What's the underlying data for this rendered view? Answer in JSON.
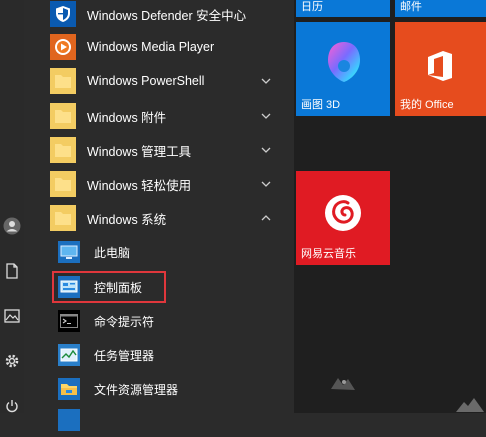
{
  "apps": [
    {
      "label": "Windows Defender 安全中心",
      "icon": "shield-icon",
      "tile_color": "#0a5ab0"
    },
    {
      "label": "Windows Media Player",
      "icon": "media-player-icon",
      "tile_color": "#e0651e"
    },
    {
      "label": "Windows PowerShell",
      "icon": "folder-icon",
      "tile_color": "#f3cc62"
    },
    {
      "label": "Windows 附件",
      "icon": "folder-icon",
      "tile_color": "#f3cc62"
    },
    {
      "label": "Windows 管理工具",
      "icon": "folder-icon",
      "tile_color": "#f3cc62"
    },
    {
      "label": "Windows 轻松使用",
      "icon": "folder-icon",
      "tile_color": "#f3cc62"
    },
    {
      "label": "Windows 系统",
      "icon": "folder-icon",
      "tile_color": "#f3cc62"
    }
  ],
  "system_items": [
    {
      "label": "此电脑",
      "icon": "this-pc-icon"
    },
    {
      "label": "控制面板",
      "icon": "control-panel-icon"
    },
    {
      "label": "命令提示符",
      "icon": "command-prompt-icon"
    },
    {
      "label": "任务管理器",
      "icon": "task-manager-icon"
    },
    {
      "label": "文件资源管理器",
      "icon": "file-explorer-icon"
    }
  ],
  "tiles": {
    "calendar": "日历",
    "mail": "邮件",
    "paint3d": "画图 3D",
    "office": "我的 Office",
    "netease": "网易云音乐"
  },
  "colors": {
    "tile_blue": "#0a78d7",
    "office_orange": "#e64c1e",
    "netease_red": "#e01b23",
    "highlight": "#e0373c"
  }
}
